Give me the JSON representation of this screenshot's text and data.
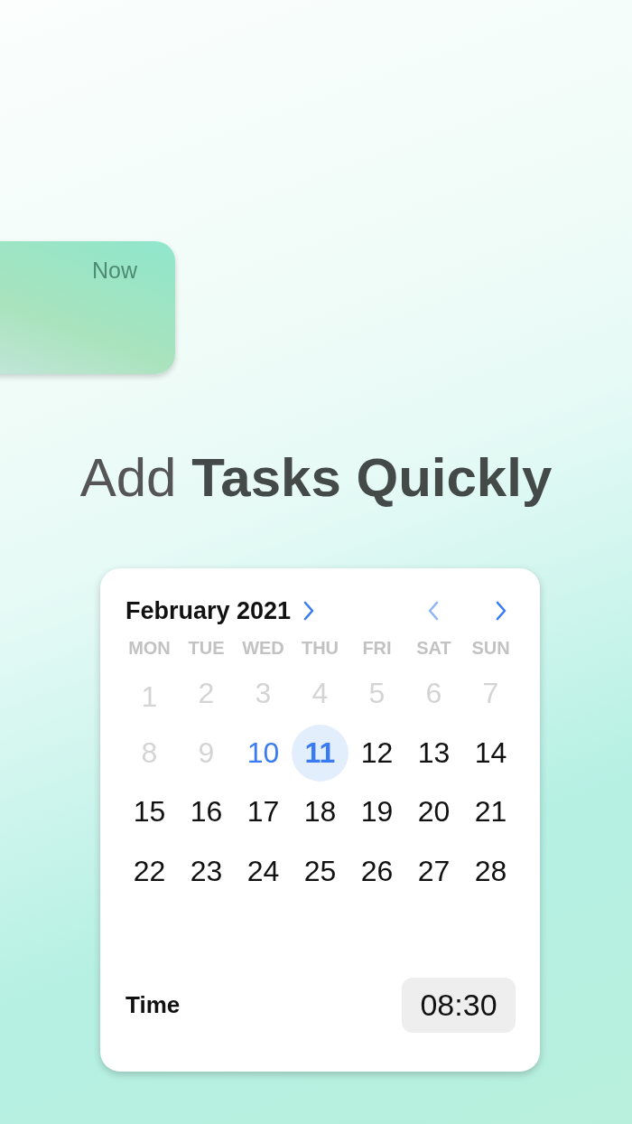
{
  "reminder_card": {
    "label": "Now"
  },
  "headline": "Add **Tasks Quickly**",
  "calendar": {
    "month": "February 2021",
    "nav": [
      {
        "kind": "prev",
        "disabled": true
      },
      {
        "kind": "next",
        "disabled": false
      }
    ],
    "weekdays": [
      "MON",
      "TUE",
      "WED",
      "THU",
      "FRI",
      "SAT",
      "SUN"
    ],
    "days": [
      {
        "label": "1",
        "disabled": true,
        "today": false,
        "selected": false
      },
      {
        "label": "2",
        "disabled": true,
        "today": false,
        "selected": false
      },
      {
        "label": "3",
        "disabled": true,
        "today": false,
        "selected": false
      },
      {
        "label": "4",
        "disabled": true,
        "today": false,
        "selected": false
      },
      {
        "label": "5",
        "disabled": true,
        "today": false,
        "selected": false
      },
      {
        "label": "6",
        "disabled": true,
        "today": false,
        "selected": false
      },
      {
        "label": "7",
        "disabled": true,
        "today": false,
        "selected": false
      },
      {
        "label": "8",
        "disabled": true,
        "today": false,
        "selected": false
      },
      {
        "label": "9",
        "disabled": true,
        "today": false,
        "selected": false
      },
      {
        "label": "10",
        "disabled": false,
        "today": true,
        "selected": false
      },
      {
        "label": "11",
        "disabled": false,
        "today": false,
        "selected": true
      },
      {
        "label": "12",
        "disabled": false,
        "today": false,
        "selected": false
      },
      {
        "label": "13",
        "disabled": false,
        "today": false,
        "selected": false
      },
      {
        "label": "14",
        "disabled": false,
        "today": false,
        "selected": false
      },
      {
        "label": "15",
        "disabled": false,
        "today": false,
        "selected": false
      },
      {
        "label": "16",
        "disabled": false,
        "today": false,
        "selected": false
      },
      {
        "label": "17",
        "disabled": false,
        "today": false,
        "selected": false
      },
      {
        "label": "18",
        "disabled": false,
        "today": false,
        "selected": false
      },
      {
        "label": "19",
        "disabled": false,
        "today": false,
        "selected": false
      },
      {
        "label": "20",
        "disabled": false,
        "today": false,
        "selected": false
      },
      {
        "label": "21",
        "disabled": false,
        "today": false,
        "selected": false
      },
      {
        "label": "22",
        "disabled": false,
        "today": false,
        "selected": false
      },
      {
        "label": "23",
        "disabled": false,
        "today": false,
        "selected": false
      },
      {
        "label": "24",
        "disabled": false,
        "today": false,
        "selected": false
      },
      {
        "label": "25",
        "disabled": false,
        "today": false,
        "selected": false
      },
      {
        "label": "26",
        "disabled": false,
        "today": false,
        "selected": false
      },
      {
        "label": "27",
        "disabled": false,
        "today": false,
        "selected": false
      },
      {
        "label": "28",
        "disabled": false,
        "today": false,
        "selected": false
      }
    ],
    "time_label": "Time",
    "time_value": "08:30"
  }
}
